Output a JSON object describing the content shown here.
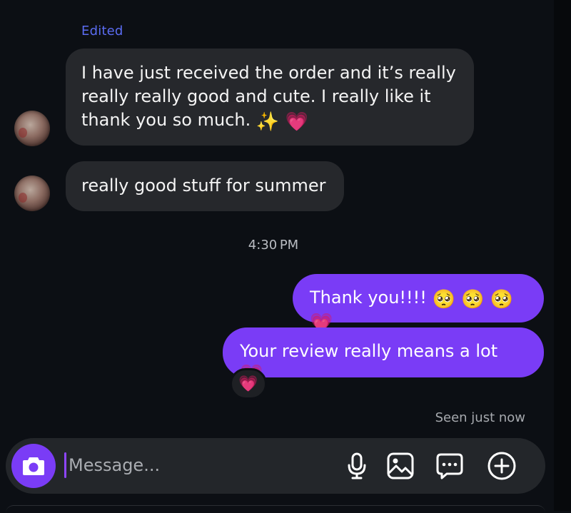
{
  "conversation": {
    "edited_label": "Edited",
    "incoming": [
      {
        "line1": "I have just received the order and it’s really",
        "line2": "really really good and cute. I really like it",
        "line3": "thank you so much.",
        "emojis": "✨ 💗"
      },
      {
        "text": "really good stuff for summer"
      }
    ],
    "timestamp": "4:30 PM",
    "outgoing": [
      {
        "text": "Thank you!!!!",
        "emojis": "🥺 🥺 🥺 💗"
      },
      {
        "text": "Your review really means a lot",
        "emojis": "💗"
      }
    ],
    "reaction": "💗",
    "seen_status": "Seen just now"
  },
  "composer": {
    "placeholder": "Message...",
    "icons": [
      "camera-icon",
      "microphone-icon",
      "image-icon",
      "sticker-chat-icon",
      "add-circle-icon"
    ]
  },
  "colors": {
    "background": "#0c0f14",
    "incoming_bubble": "#26282c",
    "outgoing_bubble": "#7a3cf6",
    "edited_label": "#5b6cf2",
    "accent": "#7a3cf6"
  }
}
